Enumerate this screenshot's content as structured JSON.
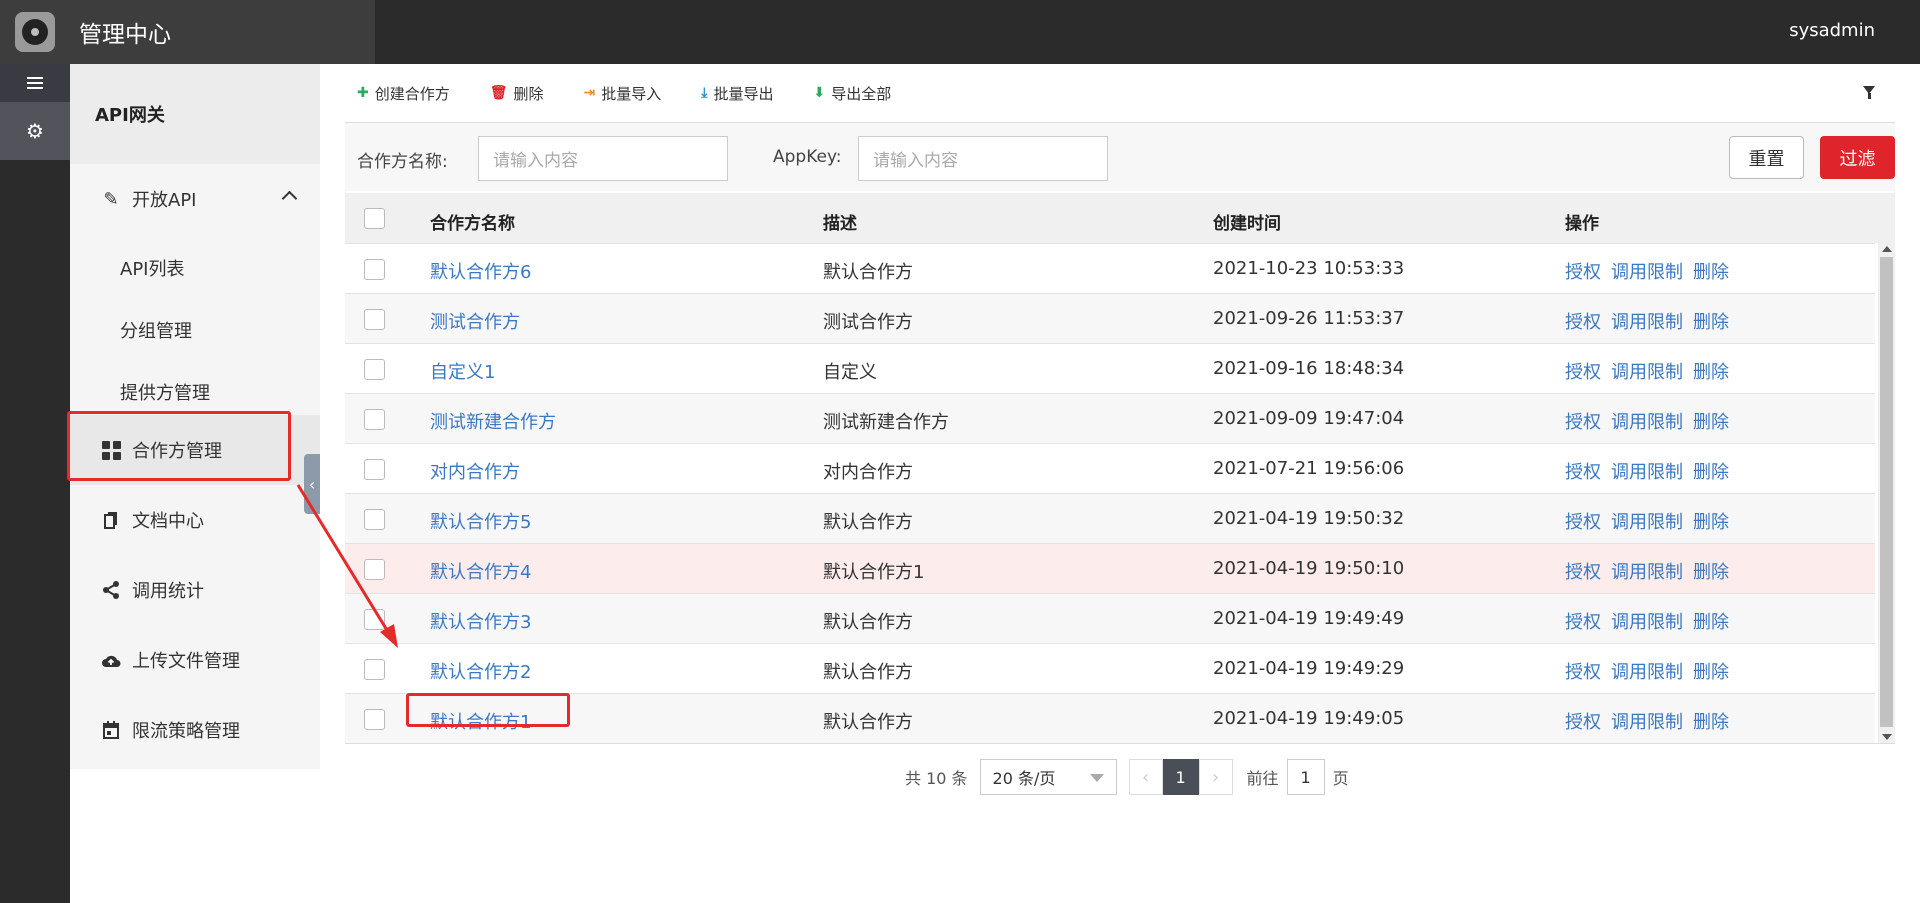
{
  "header": {
    "title": "管理中心",
    "user": "sysadmin"
  },
  "sidebar": {
    "section_title": "API网关",
    "open_api": "开放API",
    "sub_items": [
      "API列表",
      "分组管理",
      "提供方管理"
    ],
    "items": [
      {
        "label": "合作方管理",
        "icon": "grid-icon"
      },
      {
        "label": "文档中心",
        "icon": "document-icon"
      },
      {
        "label": "调用统计",
        "icon": "share-icon"
      },
      {
        "label": "上传文件管理",
        "icon": "cloud-upload-icon"
      },
      {
        "label": "限流策略管理",
        "icon": "calendar-icon"
      }
    ]
  },
  "toolbar": {
    "create": "创建合作方",
    "delete": "删除",
    "import": "批量导入",
    "export": "批量导出",
    "export_all": "导出全部"
  },
  "search": {
    "name_label": "合作方名称:",
    "name_placeholder": "请输入内容",
    "appkey_label": "AppKey:",
    "appkey_placeholder": "请输入内容",
    "reset": "重置",
    "filter": "过滤"
  },
  "table": {
    "columns": [
      "合作方名称",
      "描述",
      "创建时间",
      "操作"
    ],
    "ops": [
      "授权",
      "调用限制",
      "删除"
    ],
    "rows": [
      {
        "name": "默认合作方6",
        "desc": "默认合作方",
        "time": "2021-10-23 10:53:33"
      },
      {
        "name": "测试合作方",
        "desc": "测试合作方",
        "time": "2021-09-26 11:53:37"
      },
      {
        "name": "自定义1",
        "desc": "自定义",
        "time": "2021-09-16 18:48:34"
      },
      {
        "name": "测试新建合作方",
        "desc": "测试新建合作方",
        "time": "2021-09-09 19:47:04"
      },
      {
        "name": "对内合作方",
        "desc": "对内合作方",
        "time": "2021-07-21 19:56:06"
      },
      {
        "name": "默认合作方5",
        "desc": "默认合作方",
        "time": "2021-04-19 19:50:32"
      },
      {
        "name": "默认合作方4",
        "desc": "默认合作方1",
        "time": "2021-04-19 19:50:10"
      },
      {
        "name": "默认合作方3",
        "desc": "默认合作方",
        "time": "2021-04-19 19:49:49"
      },
      {
        "name": "默认合作方2",
        "desc": "默认合作方",
        "time": "2021-04-19 19:49:29"
      },
      {
        "name": "默认合作方1",
        "desc": "默认合作方",
        "time": "2021-04-19 19:49:05"
      }
    ]
  },
  "pagination": {
    "total": "共 10 条",
    "page_size": "20 条/页",
    "current": "1",
    "goto_label": "前往",
    "goto_value": "1",
    "page_suffix": "页"
  },
  "colors": {
    "primary_red": "#e0242b",
    "link": "#3b78c3",
    "annotation": "#e52a2a"
  }
}
